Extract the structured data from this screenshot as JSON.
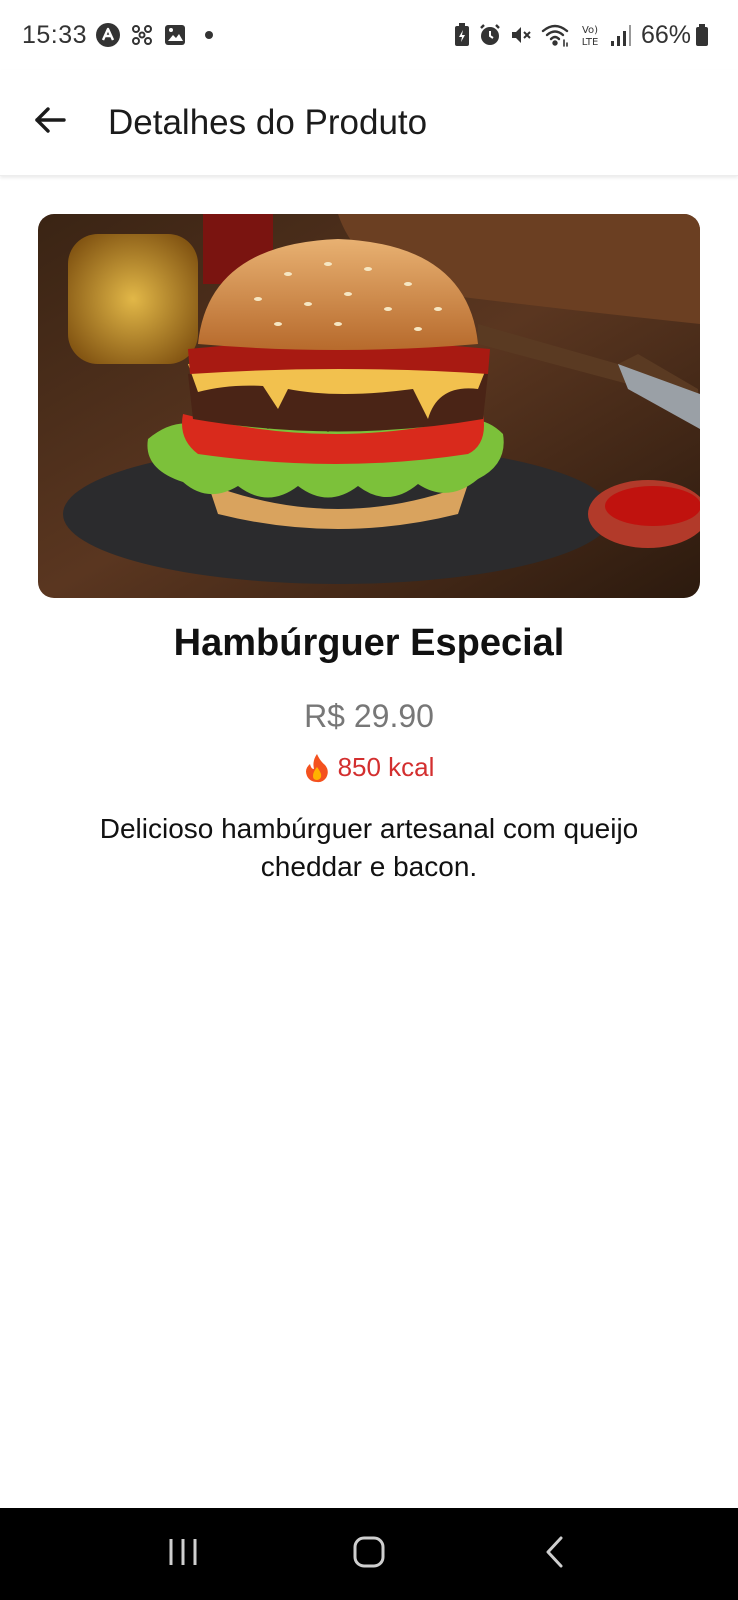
{
  "status_bar": {
    "time": "15:33",
    "battery_percent": "66%",
    "left_icons": [
      "app-a-icon",
      "network-nodes-icon",
      "gallery-icon",
      "notification-dot-icon"
    ],
    "right_icons": [
      "battery-saver-icon",
      "alarm-icon",
      "mute-icon",
      "wifi-icon",
      "volte-icon",
      "signal-icon",
      "battery-icon"
    ],
    "volte_text": "Vo) LTE"
  },
  "app_bar": {
    "title": "Detalhes do Produto",
    "back_icon": "arrow-back-icon"
  },
  "product": {
    "name": "Hambúrguer Especial",
    "price": "R$ 29.90",
    "kcal": "850 kcal",
    "kcal_icon": "fire-icon",
    "description": "Delicioso hambúrguer artesanal com queijo cheddar e bacon.",
    "image": "burger-photo"
  },
  "nav_bar": {
    "buttons": [
      "recent-apps-icon",
      "home-icon",
      "back-icon"
    ]
  },
  "colors": {
    "kcal": "#d32f2f",
    "price": "#777777",
    "nav_bar": "#000000"
  }
}
